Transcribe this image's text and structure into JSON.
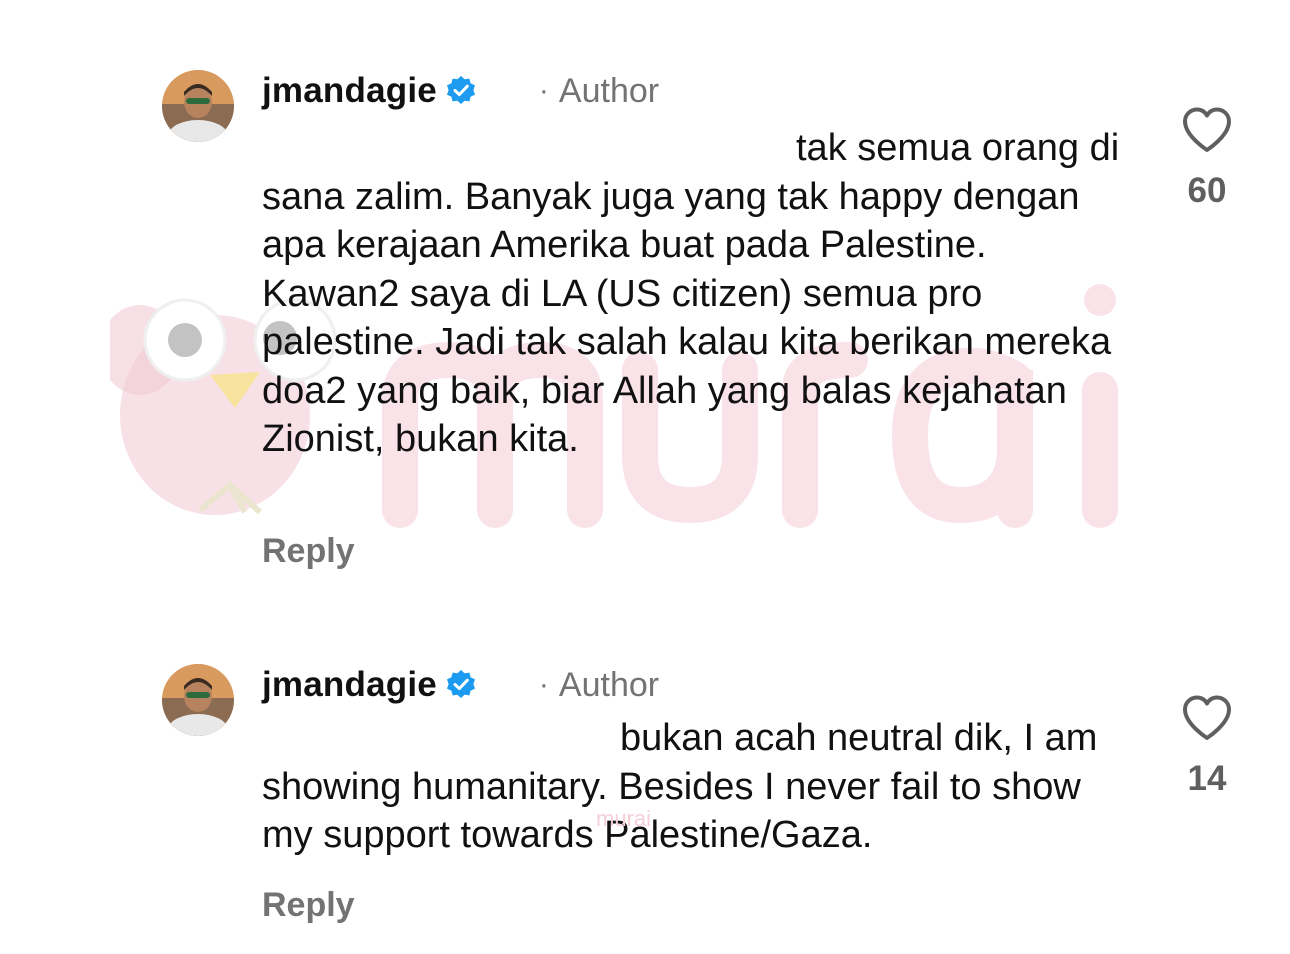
{
  "comments": [
    {
      "username": "jmandagie",
      "author_label": "Author",
      "text": "tak semua orang di sana zalim. Banyak juga yang tak happy dengan apa kerajaan Amerika buat pada Palestine. Kawan2 saya di LA (US citizen) semua pro palestine. Jadi tak salah kalau kita berikan mereka doa2 yang baik, biar Allah yang balas kejahatan Zionist, bukan kita.",
      "reply_label": "Reply",
      "likes": "60"
    },
    {
      "username": "jmandagie",
      "author_label": "Author",
      "text": "bukan acah neutral dik, I am showing humanitary. Besides I never fail to show my support towards Palestine/Gaza.",
      "reply_label": "Reply",
      "likes": "14"
    }
  ],
  "icons": {
    "verified": "verified-badge-icon",
    "like": "heart-outline-icon"
  },
  "colors": {
    "verified_blue": "#1d9bf0",
    "muted_text": "#737373",
    "watermark_pink": "#f3c7d2"
  },
  "watermark": {
    "text": "murai"
  }
}
